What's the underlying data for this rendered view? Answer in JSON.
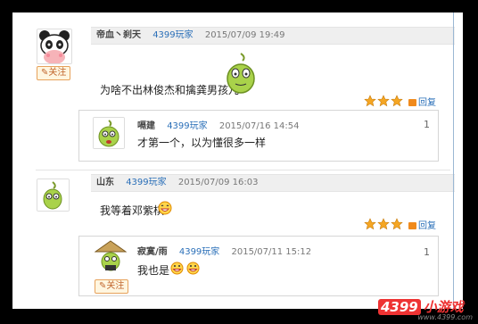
{
  "follow_label": "关注",
  "reply_label": "回复",
  "posts": [
    {
      "user": "帝血丶刹天",
      "tag": "4399玩家",
      "time": "2015/07/09 19:49",
      "message": "为啥不出林俊杰和擒龚男孩儿",
      "replies": [
        {
          "user": "嗝建",
          "tag": "4399玩家",
          "time": "2015/07/16 14:54",
          "message": "才第一个，以为懂很多一样",
          "index": "1"
        }
      ]
    },
    {
      "user": "山东",
      "tag": "4399玩家",
      "time": "2015/07/09 16:03",
      "message": "我等着邓紫棋",
      "replies": [
        {
          "user": "寂寞/雨",
          "tag": "4399玩家",
          "time": "2015/07/11 15:12",
          "message": "我也是",
          "index": "1"
        }
      ]
    }
  ],
  "watermark": {
    "brand": "4399",
    "site": "小游戏",
    "url": "www.4399.com"
  },
  "colors": {
    "accent_link": "#2a6fb8",
    "star": "#f5a623",
    "follow": "#e7a25b"
  }
}
